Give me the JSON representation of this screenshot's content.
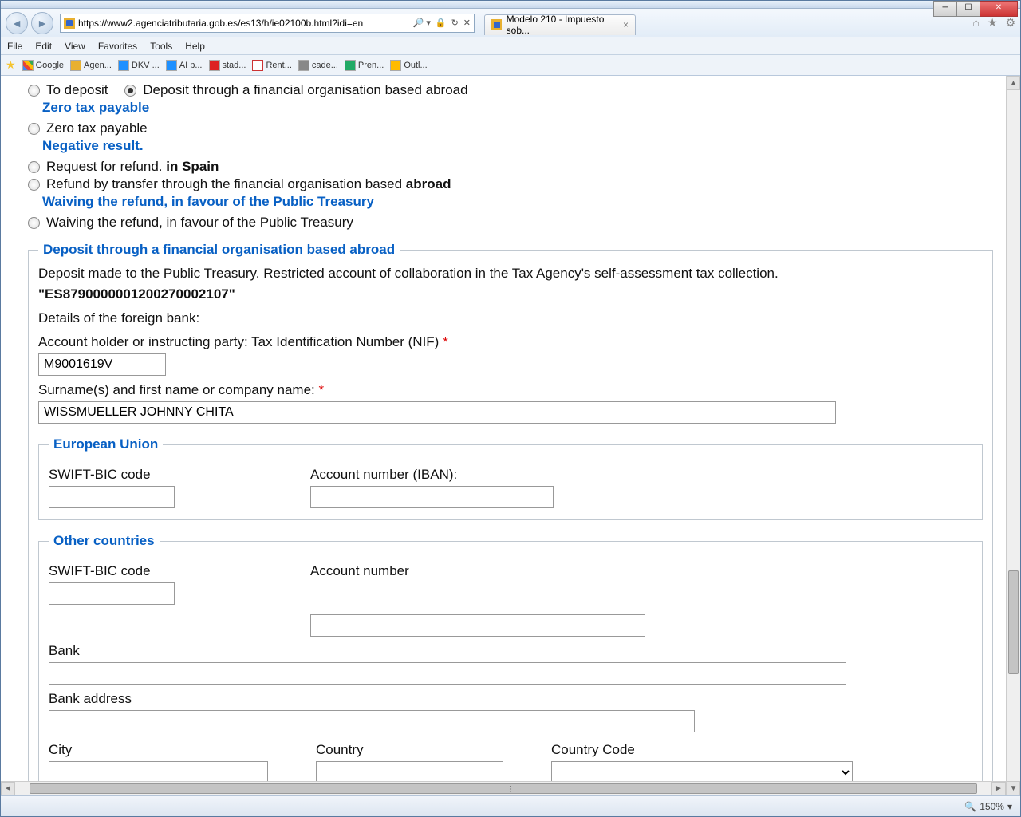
{
  "window": {
    "url": "https://www2.agenciatributaria.gob.es/es13/h/ie02100b.html?idi=en",
    "tab_title": "Modelo 210 - Impuesto sob..."
  },
  "menu": {
    "file": "File",
    "edit": "Edit",
    "view": "View",
    "favorites": "Favorites",
    "tools": "Tools",
    "help": "Help"
  },
  "favbar": {
    "items": [
      "Google",
      "Agen...",
      "DKV ...",
      "AI p...",
      "stad...",
      "Rent...",
      "cade...",
      "Pren...",
      "Outl..."
    ]
  },
  "options": {
    "to_deposit": "To deposit",
    "deposit_abroad": "Deposit through a financial organisation based abroad",
    "zero_head": "Zero tax payable",
    "zero_opt": "Zero tax payable",
    "negative_head": "Negative result.",
    "refund_spain_pre": "Request for refund. ",
    "refund_spain_bold": "in Spain",
    "refund_abroad_pre": "Refund by transfer through the financial organisation based ",
    "refund_abroad_bold": "abroad",
    "waive_head": "Waiving the refund, in favour of the Public Treasury",
    "waive_opt": "Waiving the refund, in favour of the Public Treasury"
  },
  "deposit_section": {
    "legend": "Deposit through a financial organisation based abroad",
    "intro": "Deposit made to the Public Treasury. Restricted account of collaboration in the Tax Agency's self-assessment tax collection.",
    "iban_literal": "\"ES8790000001200270002107\"",
    "details_label": "Details of the foreign bank:",
    "nif_label": "Account holder or instructing party: Tax Identification Number (NIF) ",
    "nif_value": "M9001619V",
    "name_label": "Surname(s) and first name or company name: ",
    "name_value": "WISSMUELLER JOHNNY CHITA"
  },
  "eu_section": {
    "legend": "European Union",
    "swift_label": "SWIFT-BIC code",
    "iban_label": "Account number (IBAN):",
    "swift_value": "",
    "iban_value": ""
  },
  "other_section": {
    "legend": "Other countries",
    "swift_label": "SWIFT-BIC code",
    "acct_label": "Account number",
    "bank_label": "Bank",
    "addr_label": "Bank address",
    "city_label": "City",
    "country_label": "Country",
    "ccode_label": "Country Code",
    "swift_value": "",
    "acct_value": "",
    "bank_value": "",
    "addr_value": "",
    "city_value": "",
    "country_value": "",
    "ccode_value": ""
  },
  "status": {
    "zoom": "150%"
  }
}
